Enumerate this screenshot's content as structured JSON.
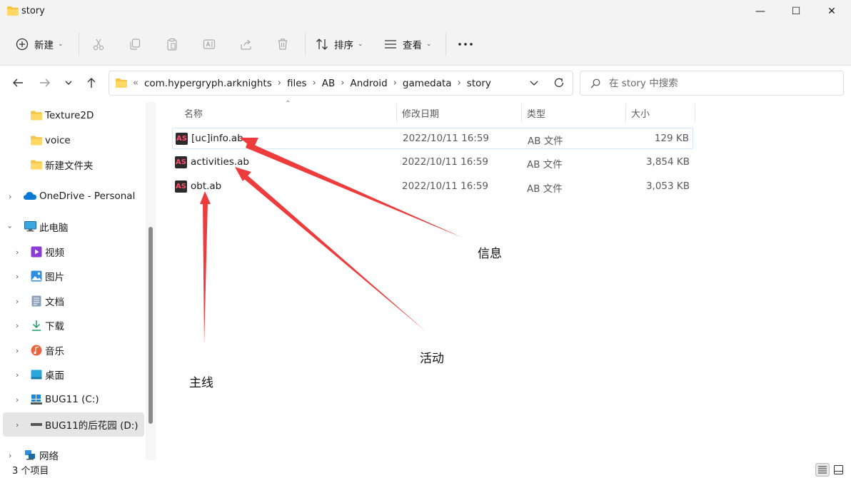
{
  "window": {
    "title": "story",
    "minimize_glyph": "—",
    "maximize_glyph": "☐",
    "close_glyph": "✕"
  },
  "toolbar": {
    "new_label": "新建",
    "sort_label": "排序",
    "view_label": "查看",
    "more_glyph": "···",
    "icons": [
      "plus-circle-icon",
      "cut-icon",
      "copy-icon",
      "paste-icon",
      "rename-icon",
      "share-icon",
      "delete-icon",
      "sort-icon",
      "view-icon",
      "more-icon"
    ]
  },
  "address": {
    "overflow": "«",
    "crumbs": [
      "com.hypergryph.arknights",
      "files",
      "AB",
      "Android",
      "gamedata",
      "story"
    ],
    "separator": "›"
  },
  "search": {
    "placeholder": "在 story 中搜索"
  },
  "sidebar": {
    "items": [
      {
        "label": "Texture2D",
        "icon": "folder-icon"
      },
      {
        "label": "voice",
        "icon": "folder-icon"
      },
      {
        "label": "新建文件夹",
        "icon": "folder-icon"
      },
      {
        "label": "OneDrive - Personal",
        "icon": "onedrive-cloud-icon"
      },
      {
        "label": "此电脑",
        "icon": "computer-icon"
      },
      {
        "label": "视频",
        "icon": "video-folder-icon"
      },
      {
        "label": "图片",
        "icon": "pictures-folder-icon"
      },
      {
        "label": "文档",
        "icon": "documents-folder-icon"
      },
      {
        "label": "下载",
        "icon": "download-icon"
      },
      {
        "label": "音乐",
        "icon": "music-icon"
      },
      {
        "label": "桌面",
        "icon": "desktop-icon"
      },
      {
        "label": "BUG11 (C:)",
        "icon": "windows-drive-icon"
      },
      {
        "label": "BUG11的后花园 (D:)",
        "icon": "drive-icon"
      },
      {
        "label": "网络",
        "icon": "network-icon"
      }
    ]
  },
  "columns": {
    "name": "名称",
    "modified": "修改日期",
    "type": "类型",
    "size": "大小"
  },
  "files": [
    {
      "name": "[uc]info.ab",
      "modified": "2022/10/11 16:59",
      "type": "AB 文件",
      "size": "129 KB",
      "icon_text": "AS"
    },
    {
      "name": "activities.ab",
      "modified": "2022/10/11 16:59",
      "type": "AB 文件",
      "size": "3,854 KB",
      "icon_text": "AS"
    },
    {
      "name": "obt.ab",
      "modified": "2022/10/11 16:59",
      "type": "AB 文件",
      "size": "3,053 KB",
      "icon_text": "AS"
    }
  ],
  "annotations": {
    "info": "信息",
    "activities": "活动",
    "main": "主线",
    "arrow_color": "#ee3b3b"
  },
  "status": {
    "item_count": "3 个项目"
  }
}
